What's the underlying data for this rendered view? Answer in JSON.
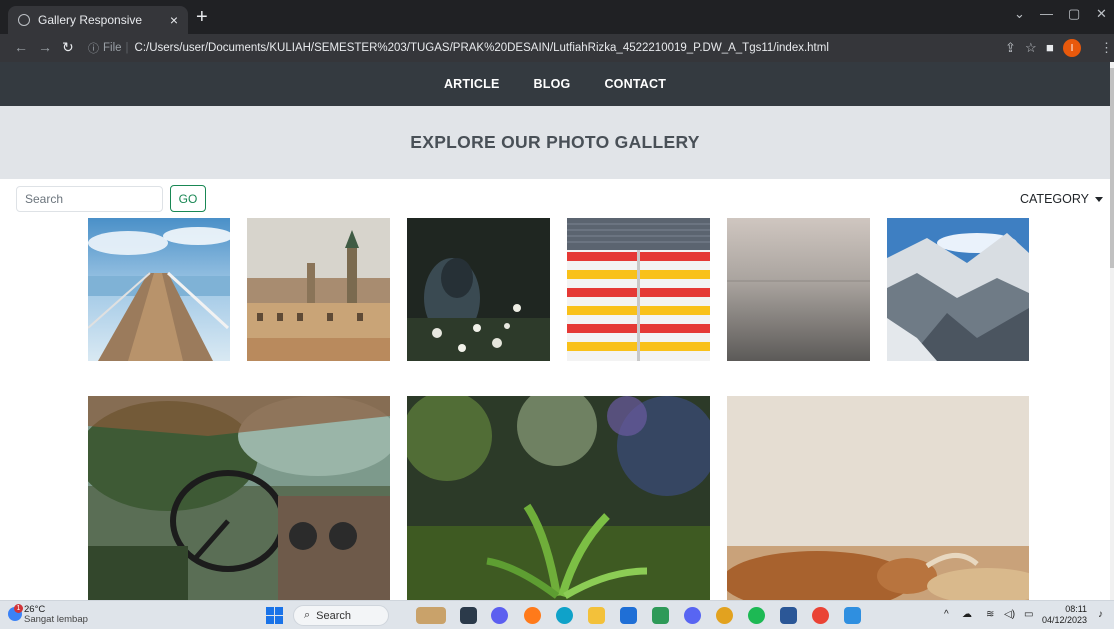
{
  "browser": {
    "tab_title": "Gallery Responsive",
    "tab_close": "×",
    "new_tab": "+",
    "url_info": "ⓘ",
    "url_scheme": "File",
    "url_separator": "|",
    "url": "C:/Users/user/Documents/KULIAH/SEMESTER%203/TUGAS/PRAK%20DESAIN/LutfiahRizka_4522210019_P.DW_A_Tgs11/index.html",
    "profile_initial": "I"
  },
  "nav": {
    "items": [
      {
        "label": "ARTICLE"
      },
      {
        "label": "BLOG"
      },
      {
        "label": "CONTACT"
      }
    ]
  },
  "hero": {
    "title": "EXPLORE OUR PHOTO GALLERY"
  },
  "search": {
    "placeholder": "Search",
    "button": "GO"
  },
  "category": {
    "label": "CATEGORY"
  },
  "gallery": {
    "row1": [
      "pier",
      "old-town-city",
      "hooded-person-flowers",
      "striped-wall",
      "misty-sea",
      "snowy-mountains"
    ],
    "row2": [
      "abandoned-truck-interior",
      "green-plant-bokeh",
      "highland-cow"
    ]
  },
  "taskbar": {
    "temperature": "26°C",
    "weather_desc": "Sangat lembap",
    "weather_badge": "1",
    "search_label": "Search",
    "time": "08:11",
    "date": "04/12/2023"
  }
}
